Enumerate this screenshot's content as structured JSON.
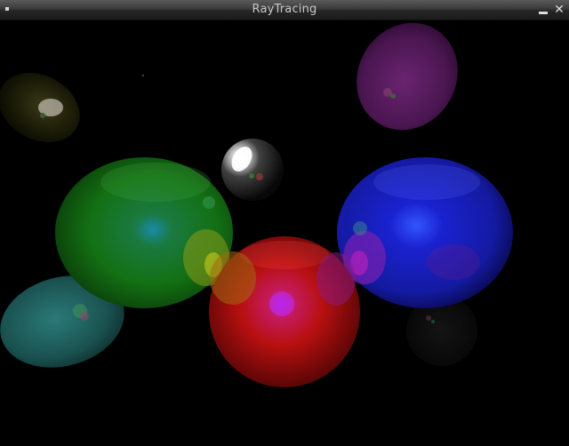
{
  "window": {
    "title": "RayTracing",
    "close_symbol": "✕"
  },
  "scene": {
    "background": "#000000",
    "spheres": [
      {
        "name": "sphere-dark-olive",
        "color": "#2a2a0c"
      },
      {
        "name": "sphere-purple",
        "color": "#5a1a5e"
      },
      {
        "name": "sphere-white",
        "color": "#d0d0d0"
      },
      {
        "name": "sphere-green",
        "color": "#1a8a1a"
      },
      {
        "name": "sphere-blue",
        "color": "#1a22d0"
      },
      {
        "name": "sphere-teal",
        "color": "#1e6f6a"
      },
      {
        "name": "sphere-red",
        "color": "#d01a1a"
      },
      {
        "name": "sphere-faint-dark",
        "color": "#101010"
      }
    ]
  }
}
